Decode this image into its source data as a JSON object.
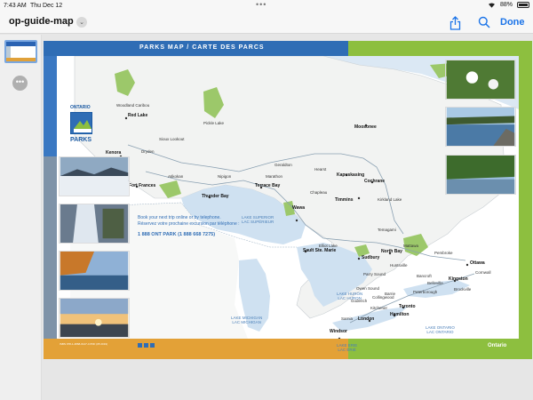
{
  "status_bar": {
    "time": "7:43 AM",
    "date": "Thu Dec 12",
    "battery": "88%"
  },
  "toolbar": {
    "title": "op-guide-map",
    "done_label": "Done"
  },
  "page": {
    "header_title": "PARKS MAP / CARTE DES PARCS",
    "logo_top": "ONTARIO",
    "logo_bottom": "PARKS",
    "booking_en": "Book your next trip online or by telephone.",
    "booking_fr": "Réservez votre prochaine excursion par téléphone :",
    "booking_phone": "1 888 ONT PARK  (1 888 668 7275)",
    "ontario_mark": "Ontario",
    "fine_print": "ISBN 978-1-4868-0147-4 PDF  (05 2019)"
  },
  "lakes": [
    {
      "key": "superior",
      "text": "LAKE SUPERIOR\nLAC SUPÉRIEUR"
    },
    {
      "key": "michigan",
      "text": "LAKE MICHIGAN\nLAC MICHIGAN"
    },
    {
      "key": "huron",
      "text": "LAKE HURON\nLAC HURON"
    },
    {
      "key": "ontario",
      "text": "LAKE ONTARIO\nLAC ONTARIO"
    },
    {
      "key": "erie",
      "text": "LAKE ERIE\nLAC ÉRIÉ"
    }
  ],
  "cities": [
    {
      "key": "red-lake",
      "text": "Red Lake",
      "big": true
    },
    {
      "key": "kenora",
      "text": "Kenora",
      "big": true
    },
    {
      "key": "fort-frances",
      "text": "Fort Frances",
      "big": true
    },
    {
      "key": "thunder-bay",
      "text": "Thunder Bay",
      "big": true
    },
    {
      "key": "terrace-bay",
      "text": "Terrace Bay",
      "big": true
    },
    {
      "key": "moosonee",
      "text": "Moosonee",
      "big": true
    },
    {
      "key": "kapuskasing",
      "text": "Kapuskasing",
      "big": true
    },
    {
      "key": "cochrane",
      "text": "Cochrane",
      "big": true
    },
    {
      "key": "timmins",
      "text": "Timmins",
      "big": true
    },
    {
      "key": "wawa",
      "text": "Wawa",
      "big": true
    },
    {
      "key": "sault",
      "text": "Sault Ste. Marie",
      "big": true
    },
    {
      "key": "sudbury",
      "text": "Sudbury",
      "big": true
    },
    {
      "key": "north-bay",
      "text": "North Bay",
      "big": true
    },
    {
      "key": "ottawa",
      "text": "Ottawa",
      "big": true
    },
    {
      "key": "kingston",
      "text": "Kingston",
      "big": true
    },
    {
      "key": "toronto",
      "text": "Toronto",
      "big": true
    },
    {
      "key": "hamilton",
      "text": "Hamilton",
      "big": true
    },
    {
      "key": "london",
      "text": "London",
      "big": true
    },
    {
      "key": "windsor",
      "text": "Windsor",
      "big": true
    },
    {
      "key": "woodland",
      "text": "Woodland Caribou",
      "big": false
    },
    {
      "key": "pickle",
      "text": "Pickle Lake",
      "big": false
    },
    {
      "key": "nipigon",
      "text": "Nipigon",
      "big": false
    },
    {
      "key": "marathon",
      "text": "Marathon",
      "big": false
    },
    {
      "key": "hearst",
      "text": "Hearst",
      "big": false
    },
    {
      "key": "chapleau",
      "text": "Chapleau",
      "big": false
    },
    {
      "key": "kirkland",
      "text": "Kirkland Lake",
      "big": false
    },
    {
      "key": "elliot",
      "text": "Elliot Lake",
      "big": false
    },
    {
      "key": "parry",
      "text": "Parry Sound",
      "big": false
    },
    {
      "key": "barrie",
      "text": "Barrie",
      "big": false
    },
    {
      "key": "kitchener",
      "text": "Kitchener",
      "big": false
    },
    {
      "key": "sarnia",
      "text": "Sarnia",
      "big": false
    },
    {
      "key": "owen",
      "text": "Owen Sound",
      "big": false
    },
    {
      "key": "peterborough",
      "text": "Peterborough",
      "big": false
    },
    {
      "key": "belleville",
      "text": "Belleville",
      "big": false
    },
    {
      "key": "cornwall",
      "text": "Cornwall",
      "big": false
    },
    {
      "key": "pembroke",
      "text": "Pembroke",
      "big": false
    },
    {
      "key": "mattawa",
      "text": "Mattawa",
      "big": false
    },
    {
      "key": "temagami",
      "text": "Temagami",
      "big": false
    },
    {
      "key": "dryden",
      "text": "Dryden",
      "big": false
    },
    {
      "key": "sioux",
      "text": "Sioux Lookout",
      "big": false
    },
    {
      "key": "atikokan",
      "text": "Atikokan",
      "big": false
    },
    {
      "key": "geraldton",
      "text": "Geraldton",
      "big": false
    },
    {
      "key": "huntsville",
      "text": "Huntsville",
      "big": false
    },
    {
      "key": "bancroft",
      "text": "Bancroft",
      "big": false
    },
    {
      "key": "brockville",
      "text": "Brockville",
      "big": false
    },
    {
      "key": "collingwood",
      "text": "Collingwood",
      "big": false
    },
    {
      "key": "goderich",
      "text": "Goderich",
      "big": false
    }
  ],
  "photos": [
    {
      "key": "winter",
      "label": "Winter shoreline"
    },
    {
      "key": "waterfall",
      "label": "Frozen waterfall"
    },
    {
      "key": "autumn",
      "label": "Autumn lake"
    },
    {
      "key": "sunset",
      "label": "Sunset"
    },
    {
      "key": "trillium",
      "label": "Trillium flowers"
    },
    {
      "key": "lake1",
      "label": "Lake with islands"
    },
    {
      "key": "lake2",
      "label": "Forest lake"
    }
  ]
}
